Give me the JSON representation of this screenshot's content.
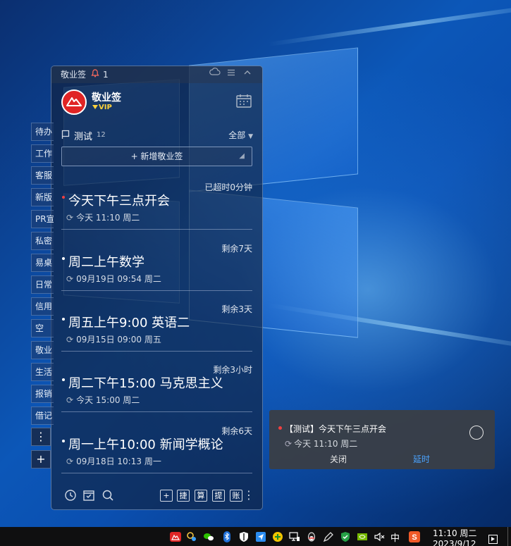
{
  "window": {
    "app_name": "敬业签",
    "reminder_count": "1"
  },
  "profile": {
    "name": "敬业签",
    "badge": "VIP"
  },
  "side_tabs": [
    "待办",
    "工作",
    "客服",
    "新版",
    "PR宣",
    "私密",
    "易桌",
    "日常",
    "信用",
    "空",
    "敬业",
    "生活",
    "报销",
    "借记"
  ],
  "side_buttons": {
    "more": "⋮",
    "add": "+"
  },
  "group": {
    "name": "测试",
    "count": "12",
    "filter": "全部"
  },
  "add_button_label": "+ 新增敬业签",
  "items": [
    {
      "remain": "已超时0分钟",
      "title": "今天下午三点开会",
      "due": "今天 11:10 周二",
      "overdue": true
    },
    {
      "remain": "剩余7天",
      "title": "周二上午数学",
      "due": "09月19日 09:54 周二",
      "overdue": false
    },
    {
      "remain": "剩余3天",
      "title": "周五上午9:00  英语二",
      "due": "09月15日 09:00 周五",
      "overdue": false
    },
    {
      "remain": "剩余3小时",
      "title": "周二下午15:00 马克思主义",
      "due": "今天 15:00 周二",
      "overdue": false
    },
    {
      "remain": "剩余6天",
      "title": "周一上午10:00  新闻学概论",
      "due": "09月18日 10:13 周一",
      "overdue": false
    }
  ],
  "bottom_tools": [
    "捷",
    "算",
    "提",
    "账"
  ],
  "notification": {
    "title": "【测试】今天下午三点开会",
    "time": "今天 11:10 周二",
    "close_label": "关闭",
    "delay_label": "延时"
  },
  "taskbar": {
    "ime": "中",
    "clock_time": "11:10 周二",
    "clock_date": "2023/9/12"
  },
  "colors": {
    "accent": "#4aa3ff",
    "overdue_dot": "#f04040",
    "vip": "#ffd23c",
    "avatar": "#e02525"
  }
}
